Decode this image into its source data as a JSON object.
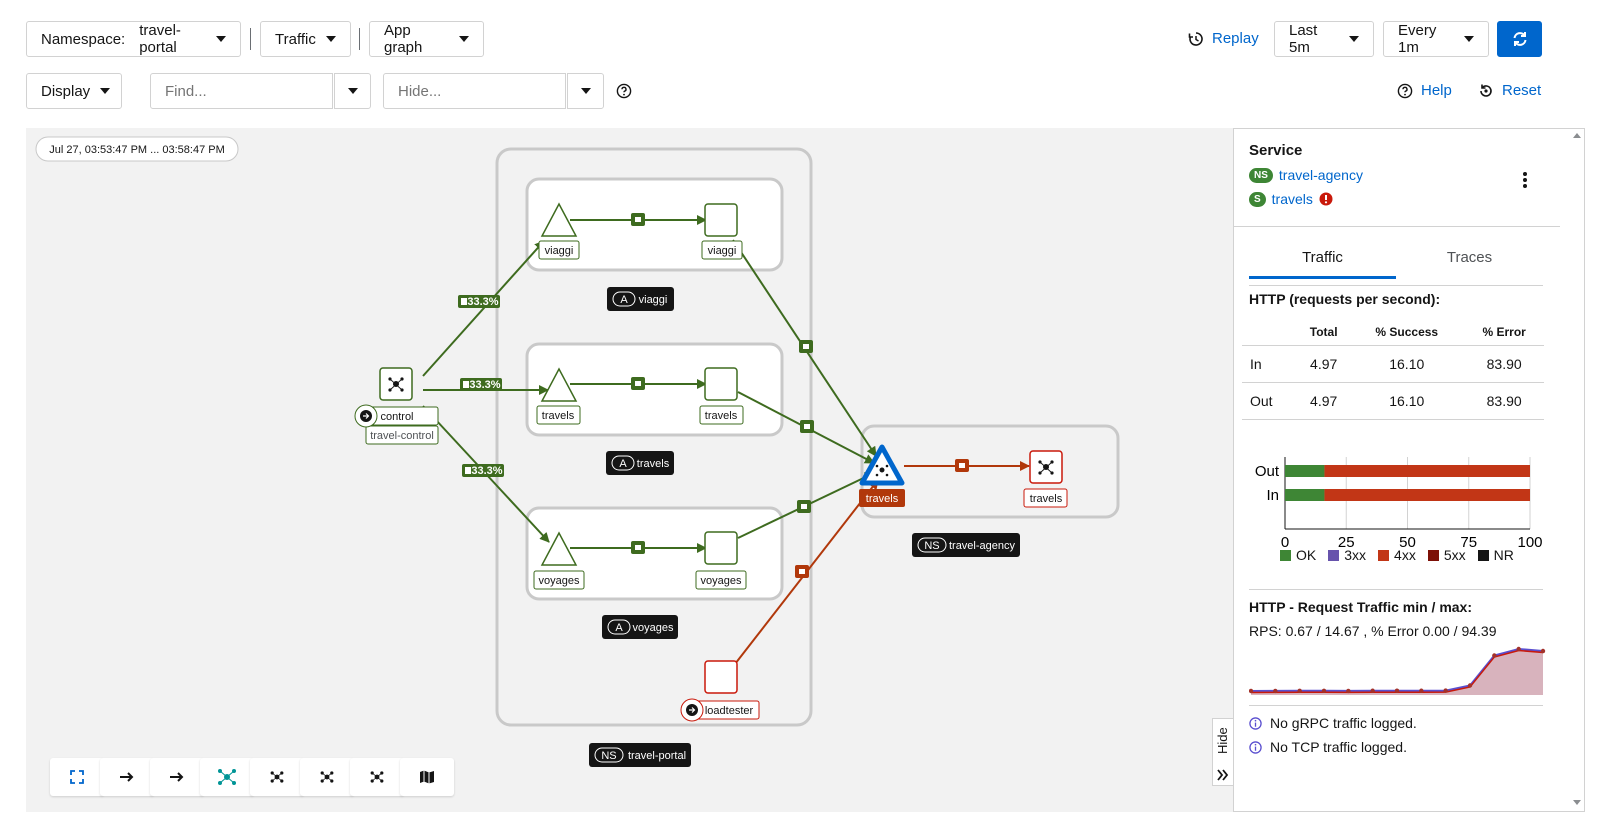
{
  "toolbar": {
    "namespace_label": "Namespace:",
    "namespace_value": "travel-portal",
    "traffic": "Traffic",
    "graph_type": "App graph",
    "replay": "Replay",
    "duration": "Last 5m",
    "refresh_interval": "Every 1m",
    "display": "Display",
    "find_placeholder": "Find...",
    "hide_placeholder": "Hide...",
    "help": "Help",
    "reset": "Reset"
  },
  "graph": {
    "timestamp": "Jul 27, 03:53:47 PM ... 03:58:47 PM",
    "edge_labels": [
      "33.3%",
      "33.3%",
      "33.3%"
    ],
    "nodes": {
      "viaggi_app": "viaggi",
      "viaggi_svc": "viaggi",
      "travels_app": "travels",
      "travels_svc": "travels",
      "voyages_app": "voyages",
      "voyages_svc": "voyages",
      "control": "control",
      "control_ns": "travel-control",
      "loadtester": "loadtester",
      "travels_selected": "travels",
      "travels_agency_wl": "travels"
    },
    "boxes": {
      "viaggi": "viaggi",
      "travels": "travels",
      "voyages": "voyages",
      "travel_agency": "travel-agency",
      "travel_portal": "travel-portal"
    },
    "box_badges": {
      "app": "A",
      "namespace": "NS"
    }
  },
  "side_panel": {
    "heading": "Service",
    "ns_badge": "NS",
    "namespace_link": "travel-agency",
    "svc_badge": "S",
    "service_link": "travels",
    "tabs": [
      "Traffic",
      "Traces"
    ],
    "http_title": "HTTP (requests per second):",
    "table": {
      "headers": [
        "",
        "Total",
        "% Success",
        "% Error"
      ],
      "rows": [
        [
          "In",
          "4.97",
          "16.10",
          "83.90"
        ],
        [
          "Out",
          "4.97",
          "16.10",
          "83.90"
        ]
      ]
    },
    "bar_chart": {
      "categories": [
        "Out",
        "In"
      ],
      "ok_percent": [
        16.1,
        16.1
      ],
      "4xx_percent": [
        83.9,
        83.9
      ],
      "ticks": [
        "0",
        "25",
        "50",
        "75",
        "100"
      ],
      "legend": [
        "OK",
        "3xx",
        "4xx",
        "5xx",
        "NR"
      ],
      "colors": {
        "OK": "#3e8635",
        "3xx": "#6753ac",
        "4xx": "#c23616",
        "5xx": "#7d1007",
        "NR": "#151515"
      }
    },
    "minmax_title": "HTTP - Request Traffic min / max:",
    "minmax_text": "RPS: 0.67 / 14.67 , % Error 0.00 / 94.39",
    "sparkline": [
      0.67,
      0.7,
      0.72,
      0.72,
      0.7,
      0.75,
      0.76,
      0.75,
      0.8,
      2.5,
      12.5,
      14.67,
      14.0
    ],
    "no_grpc": "No gRPC traffic logged.",
    "no_tcp": "No TCP traffic logged.",
    "hide_tab": "Hide"
  },
  "colors": {
    "accent": "#0066cc",
    "healthy": "#3e8635",
    "error": "#c23616"
  }
}
